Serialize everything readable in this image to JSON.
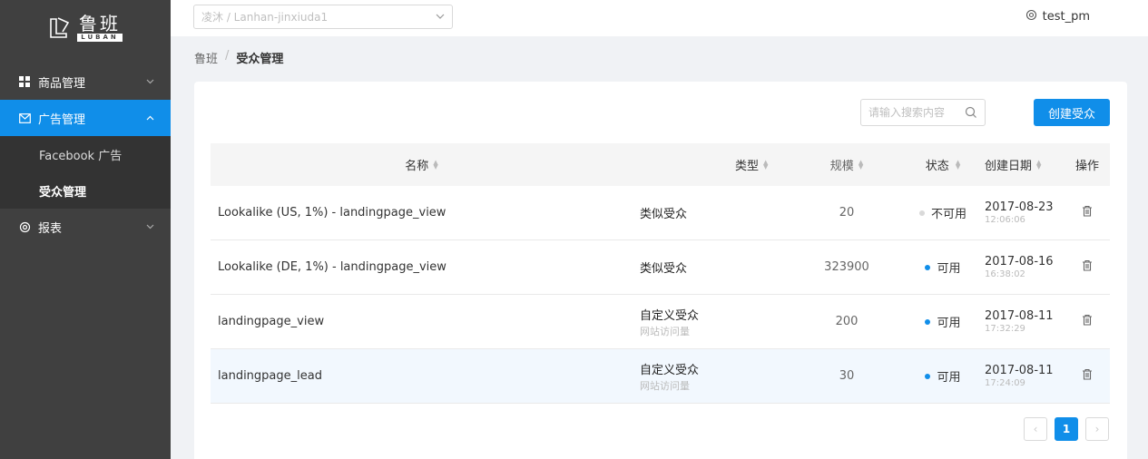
{
  "brand": {
    "name_cn": "鲁班",
    "name_en": "LUBAN"
  },
  "sidebar": {
    "items": [
      {
        "label": "商品管理",
        "icon": "grid-icon",
        "expanded": false
      },
      {
        "label": "广告管理",
        "icon": "mail-icon",
        "expanded": true,
        "active": true
      },
      {
        "label": "报表",
        "icon": "gear-icon",
        "expanded": false
      }
    ],
    "sub_items": [
      {
        "label": "Facebook 广告"
      },
      {
        "label": "受众管理",
        "active": true
      }
    ]
  },
  "header": {
    "project_select": "凌沐 / Lanhan-jinxiuda1",
    "user": "test_pm"
  },
  "breadcrumb": {
    "root": "鲁班",
    "sep": "/",
    "current": "受众管理"
  },
  "toolbar": {
    "search_placeholder": "请输入搜索内容",
    "create_label": "创建受众"
  },
  "table": {
    "columns": [
      "名称",
      "类型",
      "规模",
      "状态",
      "创建日期",
      "操作"
    ],
    "rows": [
      {
        "name": "Lookalike (US, 1%) - landingpage_view",
        "type": "类似受众",
        "type_sub": "",
        "size": "20",
        "status": "不可用",
        "status_color": "#d9d9d9",
        "date": "2017-08-23",
        "time": "12:06:06"
      },
      {
        "name": "Lookalike (DE, 1%) - landingpage_view",
        "type": "类似受众",
        "type_sub": "",
        "size": "323900",
        "status": "可用",
        "status_color": "#108ee9",
        "date": "2017-08-16",
        "time": "16:38:02"
      },
      {
        "name": "landingpage_view",
        "type": "自定义受众",
        "type_sub": "网站访问量",
        "size": "200",
        "status": "可用",
        "status_color": "#108ee9",
        "date": "2017-08-11",
        "time": "17:32:29"
      },
      {
        "name": "landingpage_lead",
        "type": "自定义受众",
        "type_sub": "网站访问量",
        "size": "30",
        "status": "可用",
        "status_color": "#108ee9",
        "date": "2017-08-11",
        "time": "17:24:09"
      }
    ]
  },
  "pagination": {
    "prev": "‹",
    "current": "1",
    "next": "›"
  },
  "colors": {
    "accent": "#108ee9",
    "sidebar_bg": "#404040"
  }
}
